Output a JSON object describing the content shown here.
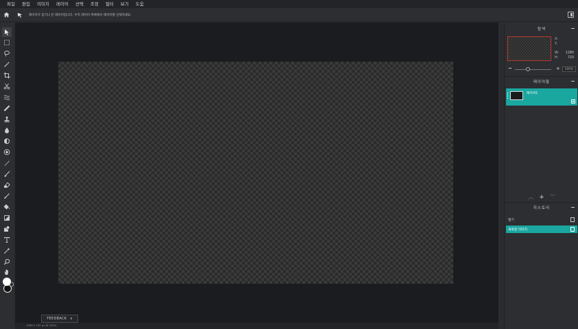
{
  "menubar": {
    "items": [
      "파일",
      "편집",
      "이미지",
      "레이어",
      "선택",
      "조정",
      "필터",
      "보기",
      "도움"
    ]
  },
  "options": {
    "hint": "레이어가 잠기나 빈 레이어입니다. 우측 레이어 목록에서 레이어를 선택하세요."
  },
  "tools": [
    {
      "name": "move-tool",
      "icon": "arrow-icon"
    },
    {
      "name": "marquee-tool",
      "icon": "dashed-rect-icon"
    },
    {
      "name": "lasso-tool",
      "icon": "lasso-icon"
    },
    {
      "name": "magic-wand-tool",
      "icon": "magic-wand-icon"
    },
    {
      "name": "crop-tool",
      "icon": "crop-icon"
    },
    {
      "name": "cut-tool",
      "icon": "scissors-icon"
    },
    {
      "name": "liquify-tool",
      "icon": "waves-icon"
    },
    {
      "name": "eraser-band-tool",
      "icon": "band-icon"
    },
    {
      "name": "stamp-tool",
      "icon": "stamp-icon"
    },
    {
      "name": "drop-tool",
      "icon": "drop-icon"
    },
    {
      "name": "dodge-tool",
      "icon": "half-circle-icon"
    },
    {
      "name": "burn-tool",
      "icon": "target-icon"
    },
    {
      "name": "pen-tool",
      "icon": "pen-icon"
    },
    {
      "name": "brush-tool",
      "icon": "brush-icon"
    },
    {
      "name": "eraser-tool",
      "icon": "eraser-icon"
    },
    {
      "name": "smudge-tool",
      "icon": "smudge-icon"
    },
    {
      "name": "fill-tool",
      "icon": "bucket-icon"
    },
    {
      "name": "gradient-tool",
      "icon": "gradient-icon"
    },
    {
      "name": "shape-tool",
      "icon": "shape-icon"
    },
    {
      "name": "text-tool",
      "icon": "text-icon"
    },
    {
      "name": "eyedropper-tool",
      "icon": "eyedropper-icon"
    },
    {
      "name": "zoom-tool",
      "icon": "magnifier-icon"
    },
    {
      "name": "hand-tool",
      "icon": "hand-icon"
    }
  ],
  "navigator": {
    "title": "탐색",
    "x_label": "X:",
    "y_label": "Y:",
    "w_label": "W:",
    "w_value": "1280",
    "h_label": "H:",
    "h_value": "720",
    "zoom": "100%"
  },
  "layers": {
    "title": "레이어들",
    "items": [
      {
        "name": "레이어1"
      }
    ]
  },
  "history": {
    "title": "히스토리",
    "items": [
      {
        "label": "열기"
      },
      {
        "label": "새로운 이미지"
      }
    ]
  },
  "feedback": {
    "label": "FEEDBACK"
  },
  "status": {
    "text": "1280 x 720 px @ 100%"
  },
  "colors": {
    "accent": "#1aa7a0",
    "canvas_bg": "#1b1c1f",
    "panel": "#2c2e31"
  }
}
